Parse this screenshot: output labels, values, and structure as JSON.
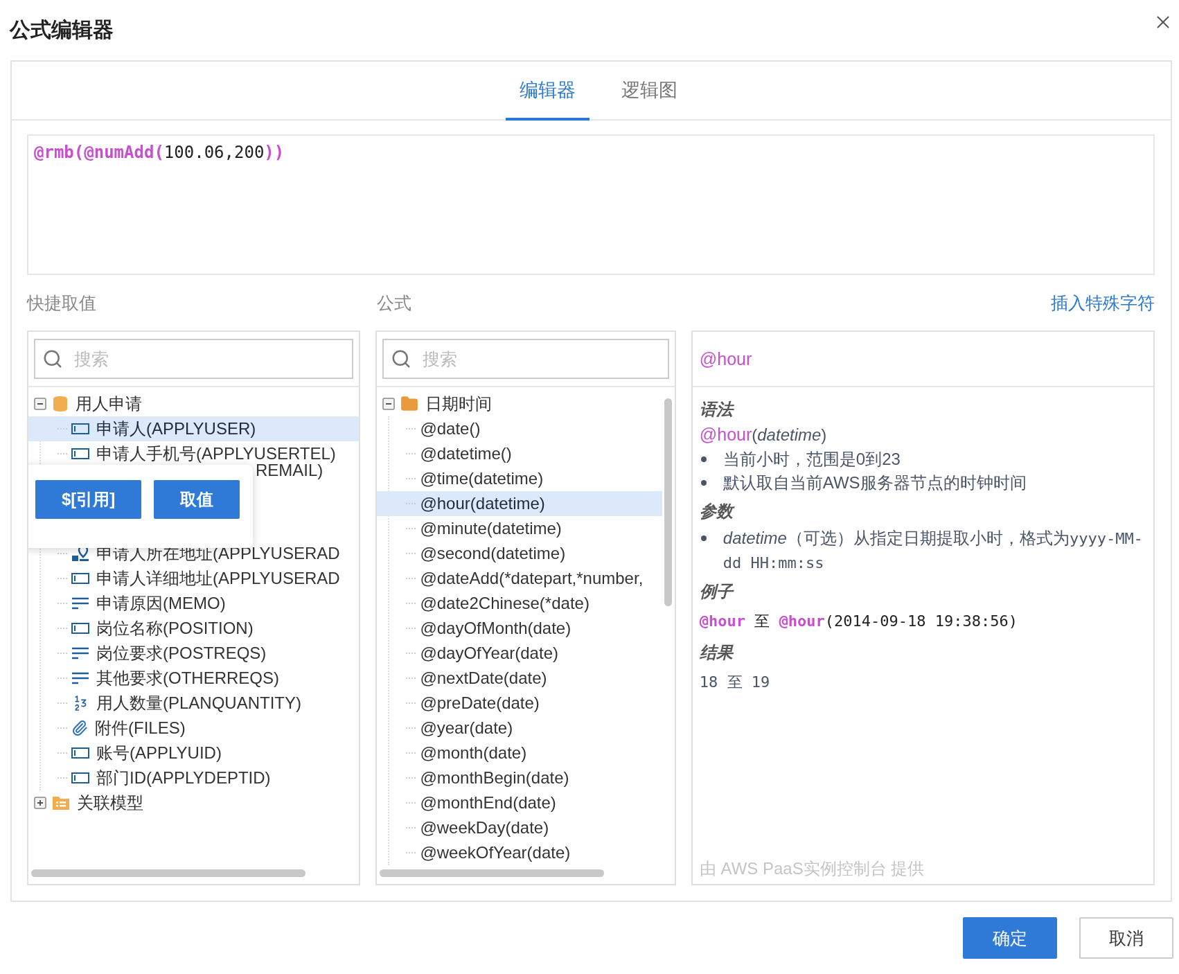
{
  "dialog": {
    "title": "公式编辑器"
  },
  "tabs": [
    {
      "label": "编辑器",
      "selected": true
    },
    {
      "label": "逻辑图",
      "selected": false
    }
  ],
  "formula": [
    {
      "text": "@rmb(",
      "kind": "function"
    },
    {
      "text": "@numAdd(",
      "kind": "function"
    },
    {
      "text": "100.06,200",
      "kind": "plain"
    },
    {
      "text": "))",
      "kind": "function"
    }
  ],
  "labels": {
    "quick_values": "快捷取值",
    "formulas": "公式",
    "insert_special": "插入特殊字符"
  },
  "quick_values": {
    "search": {
      "placeholder": "搜索"
    },
    "tree": [
      {
        "label": "用人申请",
        "kind": "database",
        "expanded": true,
        "children": [
          {
            "label": "申请人(APPLYUSER)",
            "kind": "field",
            "selected": true,
            "covered": false
          },
          {
            "label": "申请人手机号(APPLYUSERTEL)",
            "kind": "field",
            "selected": false,
            "covered": false
          },
          {
            "label": "REMAIL)",
            "covered": true
          },
          {
            "label": "申请人所在地址(APPLYUSERAD",
            "kind": "address",
            "selected": false,
            "covered": false
          },
          {
            "label": "申请人详细地址(APPLYUSERAD",
            "kind": "field",
            "selected": false,
            "covered": false
          },
          {
            "label": "申请原因(MEMO)",
            "kind": "text",
            "selected": false,
            "covered": false
          },
          {
            "label": "岗位名称(POSITION)",
            "kind": "field",
            "selected": false,
            "covered": false
          },
          {
            "label": "岗位要求(POSTREQS)",
            "kind": "text",
            "selected": false,
            "covered": false
          },
          {
            "label": "其他要求(OTHERREQS)",
            "kind": "text",
            "selected": false,
            "covered": false
          },
          {
            "label": "用人数量(PLANQUANTITY)",
            "kind": "number",
            "selected": false,
            "covered": false
          },
          {
            "label": "附件(FILES)",
            "kind": "file",
            "selected": false,
            "covered": false
          },
          {
            "label": "账号(APPLYUID)",
            "kind": "field",
            "selected": false,
            "covered": false
          },
          {
            "label": "部门ID(APPLYDEPTID)",
            "kind": "field",
            "selected": false,
            "covered": false
          }
        ]
      },
      {
        "label": "关联模型",
        "kind": "model",
        "expanded": false
      }
    ]
  },
  "popover": {
    "buttons": [
      "$[引用]",
      "取值"
    ]
  },
  "formulas": {
    "search": {
      "placeholder": "搜索"
    },
    "tree": [
      {
        "label": "日期时间",
        "kind": "folder",
        "expanded": true,
        "children": [
          {
            "label": "@date()",
            "selected": false
          },
          {
            "label": "@datetime()",
            "selected": false
          },
          {
            "label": "@time(datetime)",
            "selected": false
          },
          {
            "label": "@hour(datetime)",
            "selected": true
          },
          {
            "label": "@minute(datetime)",
            "selected": false
          },
          {
            "label": "@second(datetime)",
            "selected": false
          },
          {
            "label": "@dateAdd(*datepart,*number,",
            "selected": false
          },
          {
            "label": "@date2Chinese(*date)",
            "selected": false
          },
          {
            "label": "@dayOfMonth(date)",
            "selected": false
          },
          {
            "label": "@dayOfYear(date)",
            "selected": false
          },
          {
            "label": "@nextDate(date)",
            "selected": false
          },
          {
            "label": "@preDate(date)",
            "selected": false
          },
          {
            "label": "@year(date)",
            "selected": false
          },
          {
            "label": "@month(date)",
            "selected": false
          },
          {
            "label": "@monthBegin(date)",
            "selected": false
          },
          {
            "label": "@monthEnd(date)",
            "selected": false
          },
          {
            "label": "@weekDay(date)",
            "selected": false
          },
          {
            "label": "@weekOfYear(date)",
            "selected": false
          }
        ]
      }
    ]
  },
  "detail": {
    "title": "@hour",
    "syntax_heading": "语法",
    "syntax_function": "@hour",
    "syntax_params": "(*datetime*)",
    "notes": [
      "当前小时，范围是0到23",
      "默认取自当前AWS服务器节点的时钟时间"
    ],
    "params_heading": "参数",
    "params": [
      {
        "name": "datetime",
        "description": "（可选）从指定日期提取小时，格式为",
        "format": "yyyy-MM-dd HH:mm:ss"
      }
    ],
    "example_heading": "例子",
    "example": [
      {
        "text": "@hour",
        "kind": "function"
      },
      {
        "text": " 至 ",
        "kind": "plain"
      },
      {
        "text": "@hour",
        "kind": "function"
      },
      {
        "text": "(2014-09-18 19:38:56)",
        "kind": "plain"
      }
    ],
    "result_heading": "结果",
    "result": "18 至 19",
    "footer": "由 AWS PaaS实例控制台 提供"
  },
  "buttons": [
    {
      "label": "确定",
      "kind": "primary"
    },
    {
      "label": "取消",
      "kind": "default"
    }
  ]
}
